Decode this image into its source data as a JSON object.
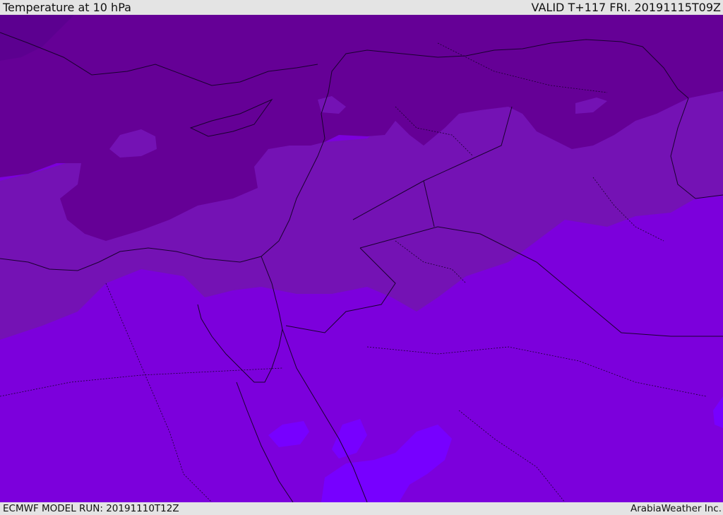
{
  "header": {
    "title": "Temperature at 10 hPa",
    "valid": "VALID T+117 FRI. 20191115T09Z"
  },
  "footer": {
    "model_run": "ECMWF MODEL RUN: 20191110T12Z",
    "credit": "ArabiaWeather Inc."
  },
  "palette": {
    "darkest": "#5c0090",
    "dark": "#650096",
    "mid": "#7412b4",
    "base": "#7c00dc",
    "light": "#8e00f6",
    "lightest": "#7700ff",
    "line": "#1a0030"
  }
}
